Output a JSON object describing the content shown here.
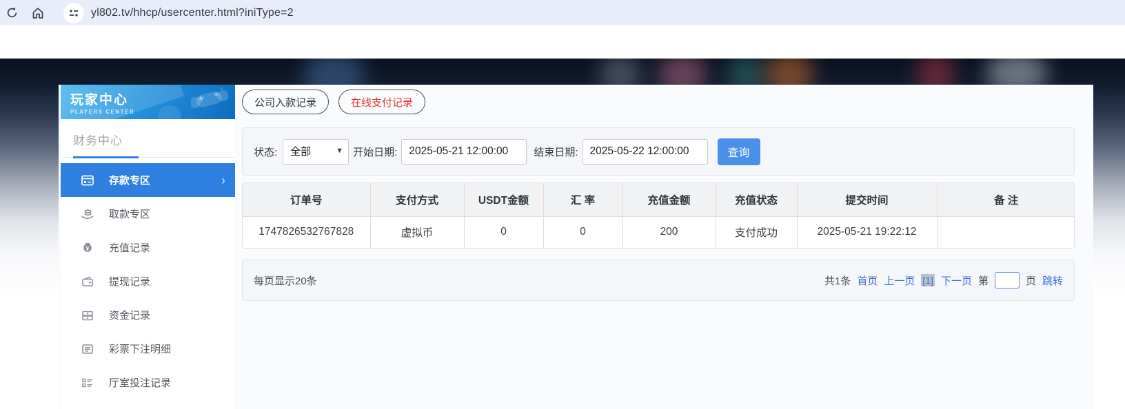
{
  "browser": {
    "url": "yl802.tv/hhcp/usercenter.html?iniType=2"
  },
  "sidebar": {
    "banner": {
      "title": "玩家中心",
      "subtitle": "PLAYERS CENTER"
    },
    "section_title": "财务中心",
    "items": [
      {
        "label": "存款专区",
        "icon": "deposit-icon",
        "active": true
      },
      {
        "label": "取款专区",
        "icon": "withdraw-zone-icon",
        "active": false
      },
      {
        "label": "充值记录",
        "icon": "recharge-record-icon",
        "active": false
      },
      {
        "label": "提现记录",
        "icon": "withdraw-record-icon",
        "active": false
      },
      {
        "label": "资金记录",
        "icon": "funds-record-icon",
        "active": false
      },
      {
        "label": "彩票下注明细",
        "icon": "lottery-bets-icon",
        "active": false
      },
      {
        "label": "厅室投注记录",
        "icon": "hall-bets-icon",
        "active": false
      }
    ]
  },
  "main": {
    "tabs": [
      {
        "label": "公司入款记录",
        "active": false
      },
      {
        "label": "在线支付记录",
        "active": true
      }
    ],
    "filter": {
      "status_label": "状态:",
      "status_value": "全部",
      "start_label": "开始日期:",
      "start_value": "2025-05-21 12:00:00",
      "end_label": "结束日期:",
      "end_value": "2025-05-22 12:00:00",
      "search_button": "查询"
    },
    "table": {
      "columns": [
        "订单号",
        "支付方式",
        "USDT金额",
        "汇 率",
        "充值金额",
        "充值状态",
        "提交时间",
        "备 注"
      ],
      "rows": [
        [
          "1747826532767828",
          "虚拟币",
          "0",
          "0",
          "200",
          "支付成功",
          "2025-05-21 19:22:12",
          ""
        ]
      ]
    },
    "pagination": {
      "page_size_text": "每页显示20条",
      "total_text": "共1条",
      "first_label": "首页",
      "prev_label": "上一页",
      "current_page": "[1]",
      "next_label": "下一页",
      "jump_prefix": "第",
      "jump_value": "",
      "jump_suffix": "页",
      "jump_button": "跳转"
    }
  },
  "colors": {
    "accent_blue": "#2e7fe0",
    "link_blue": "#3a6fd8",
    "active_tab_red": "#e6392f",
    "search_button_blue": "#4a90ea",
    "banner_gradient_start": "#45b4ec",
    "banner_gradient_end": "#0e6cc0"
  }
}
